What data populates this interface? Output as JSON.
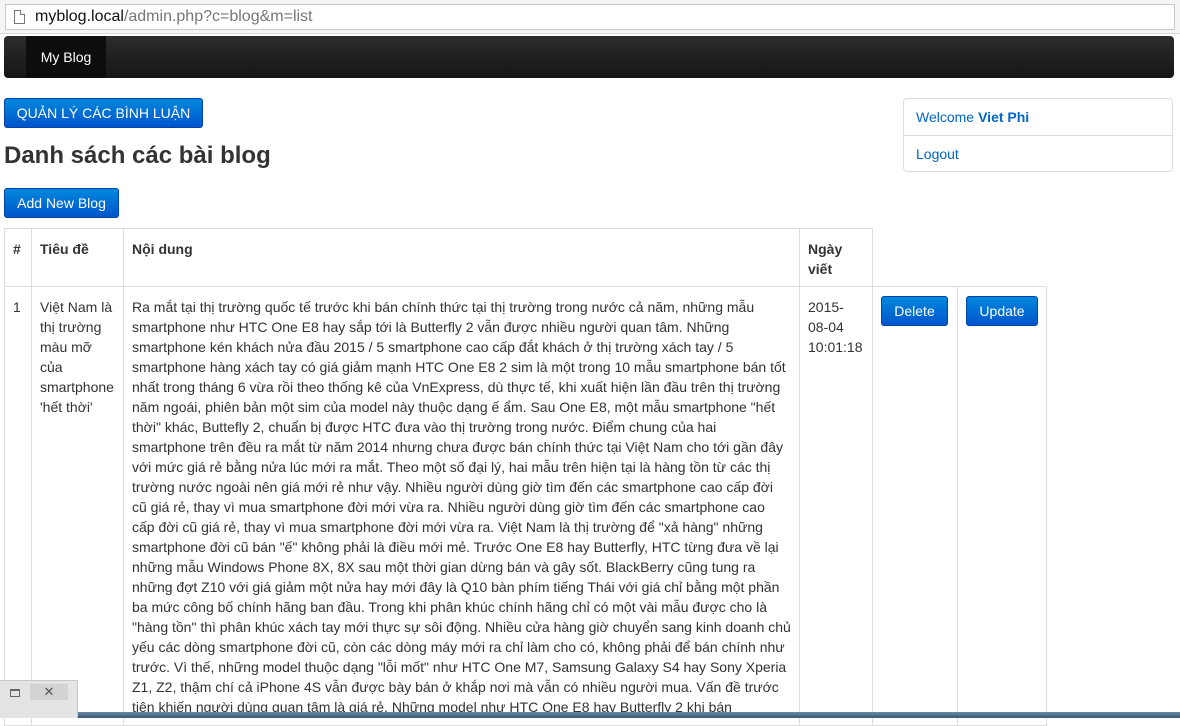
{
  "browser": {
    "url_host": "myblog.local",
    "url_path": "/admin.php?c=blog&m=list"
  },
  "navbar": {
    "brand": "My Blog"
  },
  "comments_button": "QUẢN LÝ CÁC BÌNH LUẬN",
  "page_title": "Danh sách các bài blog",
  "add_button": "Add New Blog",
  "user_panel": {
    "welcome_label": "Welcome",
    "username": "Viet Phi",
    "logout": "Logout"
  },
  "table": {
    "headers": [
      "#",
      "Tiêu đề",
      "Nội dung",
      "Ngày viết"
    ],
    "rows": [
      {
        "index": "1",
        "title": "Việt Nam là thị trường màu mỡ của smartphone 'hết thời'",
        "content": "Ra mắt tại thị trường quốc tế trước khi bán chính thức tại thị trường trong nước cả năm, những mẫu smartphone như HTC One E8 hay sắp tới là Butterfly 2 vẫn được nhiều người quan tâm. Những smartphone kén khách nửa đầu 2015 / 5 smartphone cao cấp đắt khách ở thị trường xách tay / 5 smartphone hàng xách tay có giá giảm mạnh HTC One E8 2 sim là một trong 10 mẫu smartphone bán tốt nhất trong tháng 6 vừa rồi theo thống kê của VnExpress, dù thực tế, khi xuất hiện lần đầu trên thị trường năm ngoái, phiên bản một sim của model này thuộc dạng ế ẩm. Sau One E8, một mẫu smartphone \"hết thời\" khác, Buttefly 2, chuẩn bị được HTC đưa vào thị trường trong nước. Điểm chung của hai smartphone trên đều ra mắt từ năm 2014 nhưng chưa được bán chính thức tại Việt Nam cho tới gần đây với mức giá rẻ bằng nửa lúc mới ra mắt. Theo một số đại lý, hai mẫu trên hiện tại là hàng tồn từ các thị trường nước ngoài nên giá mới rẻ như vậy. Nhiều người dùng giờ tìm đến các smartphone cao cấp đời cũ giá rẻ, thay vì mua smartphone đời mới vừa ra. Nhiều người dùng giờ tìm đến các smartphone cao cấp đời cũ giá rẻ, thay vì mua smartphone đời mới vừa ra. Việt Nam là thị trường để \"xả hàng\" những smartphone đời cũ bán \"ế\" không phải là điều mới mẻ. Trước One E8 hay Butterfly, HTC từng đưa về lại những mẫu Windows Phone 8X, 8X sau một thời gian dừng bán và gây sốt. BlackBerry cũng tung ra những đợt Z10 với giá giảm một nửa hay mới đây là Q10 bàn phím tiếng Thái với giá chỉ bằng một phần ba mức công bố chính hãng ban đầu. Trong khi phân khúc chính hãng chỉ có một vài mẫu được cho là \"hàng tồn\" thì phân khúc xách tay mới thực sự sôi động. Nhiều cửa hàng giờ chuyển sang kinh doanh chủ yếu các dòng smartphone đời cũ, còn các dòng máy mới ra chỉ làm cho có, không phải để bán chính như trước. Vì thế, những model thuộc dạng \"lỗi mốt\" như HTC One M7, Samsung Galaxy S4 hay Sony Xperia Z1, Z2, thậm chí cả iPhone 4S vẫn được bày bán ở khắp nơi mà vẫn có nhiều người mua. Vấn đề trước tiên khiến người dùng quan tâm là giá rẻ. Những model như HTC One E8 hay Butterfly 2 khi bán",
        "date": "2015-08-04 10:01:18",
        "delete_label": "Delete",
        "update_label": "Update"
      }
    ]
  },
  "taskbar_fragment": {
    "close_symbol": "✕"
  }
}
